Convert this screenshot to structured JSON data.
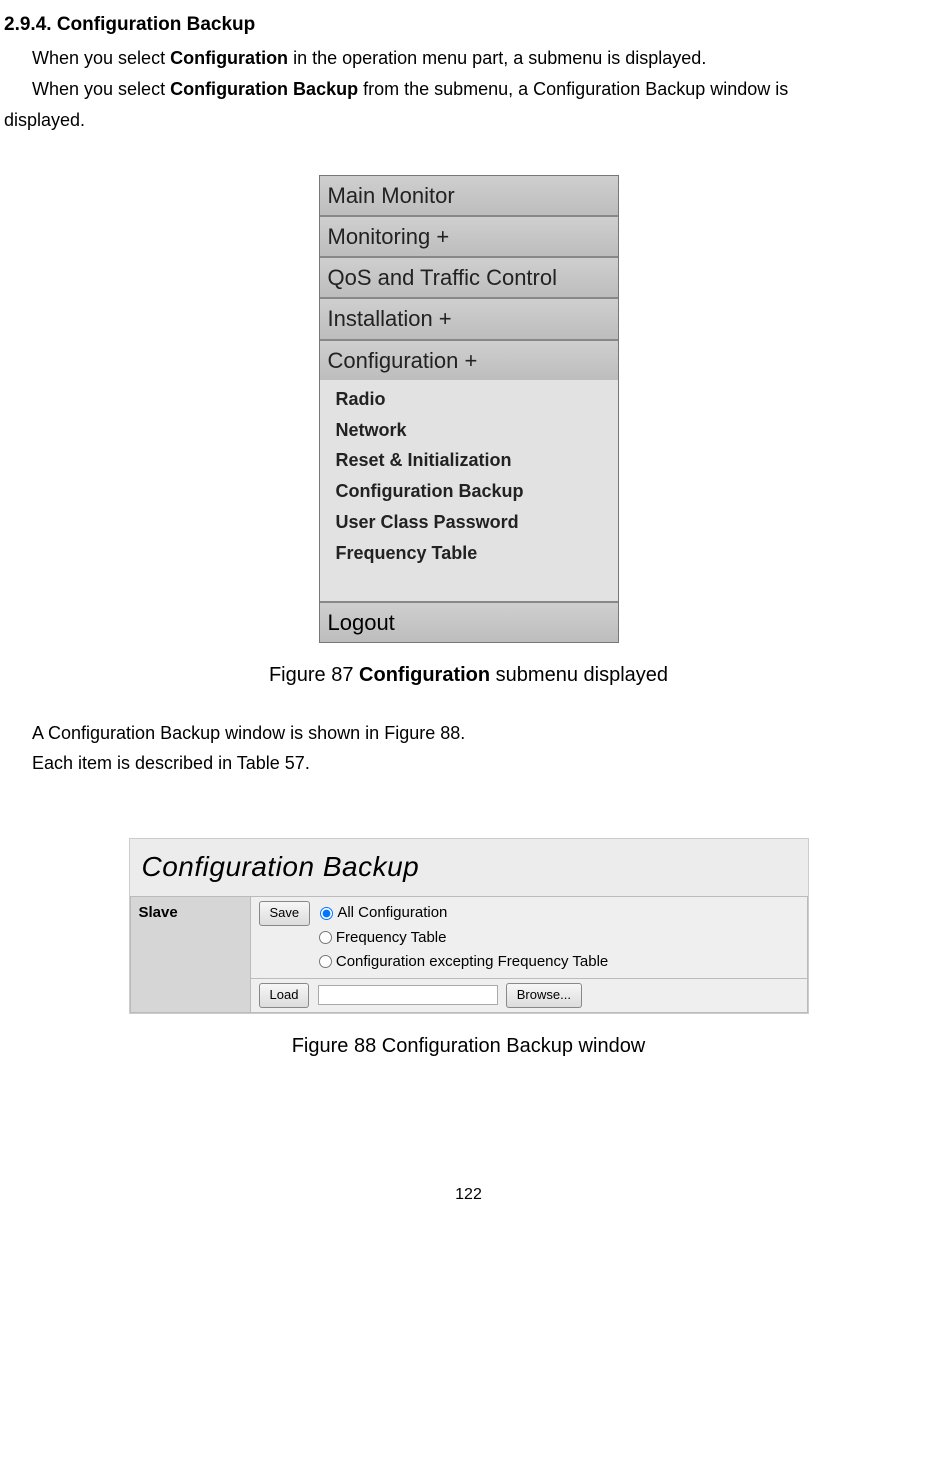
{
  "section": {
    "heading": "2.9.4. Configuration Backup",
    "line1_a": "When you select ",
    "line1_bold": "Configuration",
    "line1_b": " in the operation menu part, a submenu is displayed.",
    "line2_a": "When you select ",
    "line2_bold": "Configuration Backup",
    "line2_b": " from the submenu, a Configuration Backup window is",
    "line3": "displayed.",
    "caption87_a": "Figure 87 ",
    "caption87_bold": "Configuration",
    "caption87_b": " submenu displayed",
    "para_after1": "A Configuration Backup window is shown in Figure 88.",
    "para_after2": "Each item is described in Table 57.",
    "caption88": "Figure 88 Configuration Backup window",
    "page_number": "122"
  },
  "menu": {
    "items": [
      "Main Monitor",
      "Monitoring +",
      "QoS and Traffic Control",
      "Installation +",
      "Configuration +"
    ],
    "subitems": [
      "Radio",
      "Network",
      "Reset & Initialization",
      "Configuration Backup",
      "User Class Password",
      "Frequency Table"
    ],
    "logout": "Logout"
  },
  "config_backup": {
    "title": "Configuration Backup",
    "side_label": "Slave",
    "save_btn": "Save",
    "radio1": "All Configuration",
    "radio2": "Frequency Table",
    "radio3": "Configuration excepting Frequency Table",
    "load_btn": "Load",
    "browse_btn": "Browse..."
  }
}
